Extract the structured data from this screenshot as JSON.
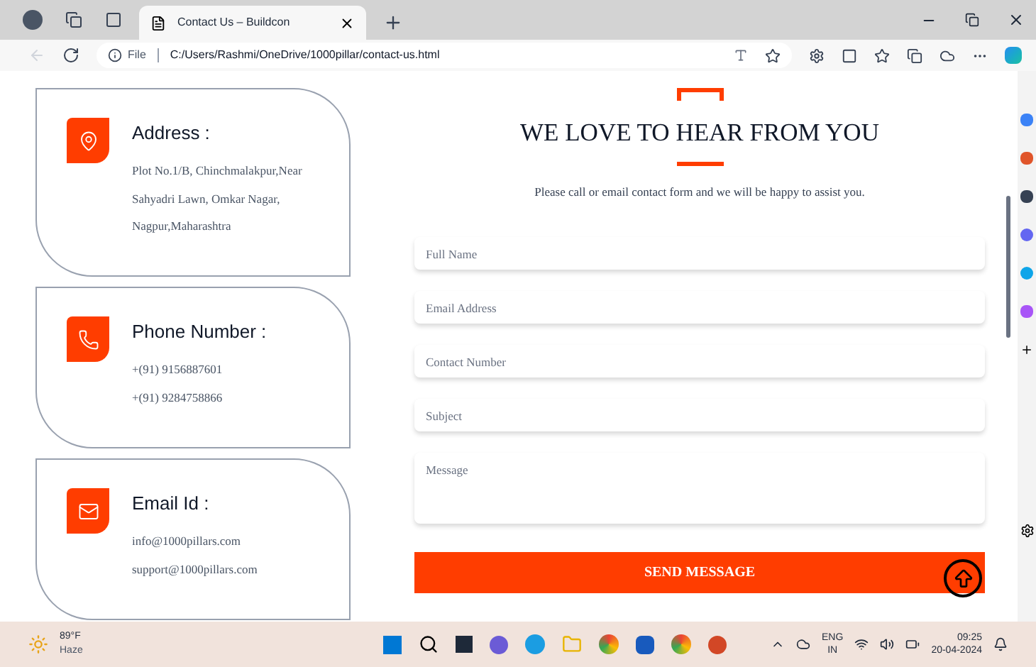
{
  "browser": {
    "tabs": [
      {
        "title": "Contact Us – Buildcon",
        "selected": true
      }
    ],
    "address": {
      "scheme": "File",
      "url": "C:/Users/Rashmi/OneDrive/1000pillar/contact-us.html"
    }
  },
  "contact_cards": [
    {
      "kind": "address",
      "title": "Address :",
      "lines": [
        "Plot No.1/B, Chinchmalakpur,Near",
        "Sahyadri Lawn, Omkar Nagar,",
        "Nagpur,Maharashtra"
      ]
    },
    {
      "kind": "phone",
      "title": "Phone Number :",
      "lines": [
        "+(91) 9156887601",
        "+(91) 9284758866"
      ]
    },
    {
      "kind": "email",
      "title": "Email Id :",
      "lines": [
        "info@1000pillars.com",
        "support@1000pillars.com"
      ]
    }
  ],
  "form": {
    "heading": "WE LOVE TO HEAR FROM YOU",
    "subtitle": "Please call or email contact form and we will be happy to assist you.",
    "fields": [
      {
        "kind": "input",
        "placeholder": "Full Name"
      },
      {
        "kind": "input",
        "placeholder": "Email Address"
      },
      {
        "kind": "input",
        "placeholder": "Contact Number"
      },
      {
        "kind": "input",
        "placeholder": "Subject"
      },
      {
        "kind": "textarea",
        "placeholder": "Message"
      }
    ],
    "submit": "SEND MESSAGE"
  },
  "taskbar": {
    "weather": {
      "temperature": "89°F",
      "condition": "Haze"
    },
    "language": "ENG",
    "region": "IN",
    "time": "09:25",
    "date": "20-04-2024"
  }
}
